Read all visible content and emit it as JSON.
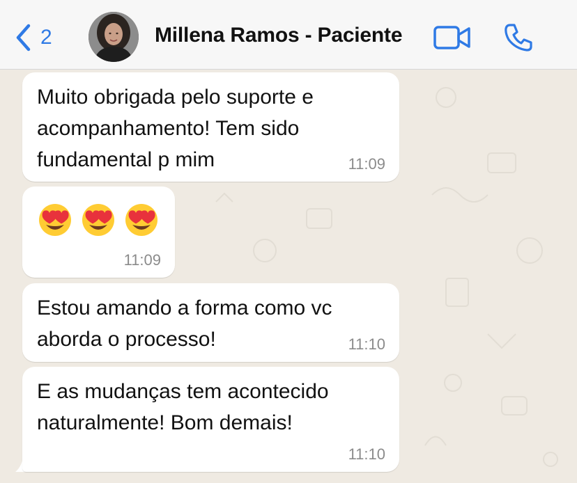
{
  "header": {
    "back_count": "2",
    "contact_name": "Millena Ramos - Paciente"
  },
  "messages": [
    {
      "text": "Muito obrigada pelo suporte e\nacompanhamento! Tem sido\nfundamental p mim",
      "time": "11:09"
    },
    {
      "text": "",
      "time": "11:09",
      "emoji_count": 3
    },
    {
      "text": "Estou amando a forma como vc\naborda o processo!",
      "time": "11:10"
    },
    {
      "text": "E as mudanças tem acontecido\nnaturalmente! Bom demais!",
      "time": "11:10"
    }
  ],
  "colors": {
    "accent": "#2f7ae5",
    "chat_background": "#efeae2",
    "bubble": "#ffffff",
    "timestamp": "#8b8b8b"
  },
  "icons": [
    "chevron-left-icon",
    "video-camera-icon",
    "phone-icon",
    "heart-eyes-emoji-icon"
  ]
}
